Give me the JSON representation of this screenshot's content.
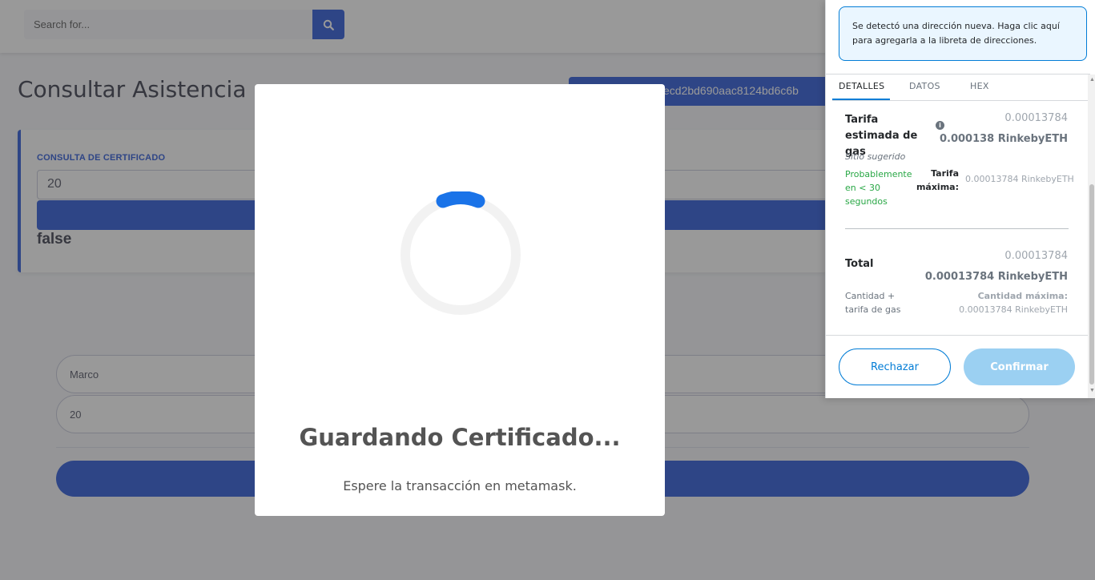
{
  "search": {
    "placeholder": "Search for..."
  },
  "page": {
    "title": "Consultar Asistencia",
    "address_text": "ecd2bd690aac8124bd6c6b"
  },
  "certificate_card": {
    "label": "CONSULTA DE CERTIFICADO",
    "input_value": "20",
    "result": "false"
  },
  "form": {
    "name_value": "Marco",
    "number_value": "20"
  },
  "modal": {
    "title": "Guardando Certificado...",
    "text": "Espere la transacción en metamask."
  },
  "metamask": {
    "notice": "Se detectó una dirección nueva. Haga clic aquí para agregarla a la libreta de direcciones.",
    "tabs": [
      "DETALLES",
      "DATOS",
      "HEX"
    ],
    "gas": {
      "title": "Tarifa estimada de gas",
      "value_small": "0.00013784",
      "value_big": "0.000138 RinkebyETH",
      "site": "Sitio sugerido",
      "likely": "Probablemente en < 30 segundos",
      "max_fee_label": "Tarifa máxima:",
      "max_fee_value": "0.00013784 RinkebyETH"
    },
    "total": {
      "label": "Total",
      "value_small": "0.00013784",
      "value_big": "0.00013784 RinkebyETH",
      "amount_label": "Cantidad + tarifa de gas",
      "max_label": "Cantidad máxima:",
      "max_value": "0.00013784 RinkebyETH"
    },
    "buttons": {
      "reject": "Rechazar",
      "confirm": "Confirmar"
    }
  },
  "colors": {
    "primary": "#4e73df",
    "metamask_blue": "#037dd6",
    "success": "#28a745"
  }
}
